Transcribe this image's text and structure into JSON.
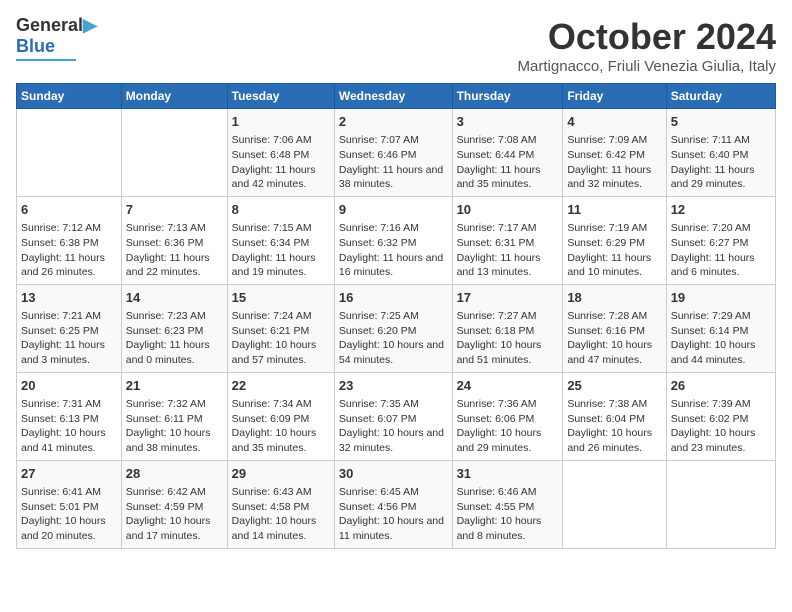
{
  "header": {
    "logo_line1": "General",
    "logo_line2": "Blue",
    "month": "October 2024",
    "location": "Martignacco, Friuli Venezia Giulia, Italy"
  },
  "days_of_week": [
    "Sunday",
    "Monday",
    "Tuesday",
    "Wednesday",
    "Thursday",
    "Friday",
    "Saturday"
  ],
  "weeks": [
    [
      {
        "day": "",
        "info": ""
      },
      {
        "day": "",
        "info": ""
      },
      {
        "day": "1",
        "info": "Sunrise: 7:06 AM\nSunset: 6:48 PM\nDaylight: 11 hours and 42 minutes."
      },
      {
        "day": "2",
        "info": "Sunrise: 7:07 AM\nSunset: 6:46 PM\nDaylight: 11 hours and 38 minutes."
      },
      {
        "day": "3",
        "info": "Sunrise: 7:08 AM\nSunset: 6:44 PM\nDaylight: 11 hours and 35 minutes."
      },
      {
        "day": "4",
        "info": "Sunrise: 7:09 AM\nSunset: 6:42 PM\nDaylight: 11 hours and 32 minutes."
      },
      {
        "day": "5",
        "info": "Sunrise: 7:11 AM\nSunset: 6:40 PM\nDaylight: 11 hours and 29 minutes."
      }
    ],
    [
      {
        "day": "6",
        "info": "Sunrise: 7:12 AM\nSunset: 6:38 PM\nDaylight: 11 hours and 26 minutes."
      },
      {
        "day": "7",
        "info": "Sunrise: 7:13 AM\nSunset: 6:36 PM\nDaylight: 11 hours and 22 minutes."
      },
      {
        "day": "8",
        "info": "Sunrise: 7:15 AM\nSunset: 6:34 PM\nDaylight: 11 hours and 19 minutes."
      },
      {
        "day": "9",
        "info": "Sunrise: 7:16 AM\nSunset: 6:32 PM\nDaylight: 11 hours and 16 minutes."
      },
      {
        "day": "10",
        "info": "Sunrise: 7:17 AM\nSunset: 6:31 PM\nDaylight: 11 hours and 13 minutes."
      },
      {
        "day": "11",
        "info": "Sunrise: 7:19 AM\nSunset: 6:29 PM\nDaylight: 11 hours and 10 minutes."
      },
      {
        "day": "12",
        "info": "Sunrise: 7:20 AM\nSunset: 6:27 PM\nDaylight: 11 hours and 6 minutes."
      }
    ],
    [
      {
        "day": "13",
        "info": "Sunrise: 7:21 AM\nSunset: 6:25 PM\nDaylight: 11 hours and 3 minutes."
      },
      {
        "day": "14",
        "info": "Sunrise: 7:23 AM\nSunset: 6:23 PM\nDaylight: 11 hours and 0 minutes."
      },
      {
        "day": "15",
        "info": "Sunrise: 7:24 AM\nSunset: 6:21 PM\nDaylight: 10 hours and 57 minutes."
      },
      {
        "day": "16",
        "info": "Sunrise: 7:25 AM\nSunset: 6:20 PM\nDaylight: 10 hours and 54 minutes."
      },
      {
        "day": "17",
        "info": "Sunrise: 7:27 AM\nSunset: 6:18 PM\nDaylight: 10 hours and 51 minutes."
      },
      {
        "day": "18",
        "info": "Sunrise: 7:28 AM\nSunset: 6:16 PM\nDaylight: 10 hours and 47 minutes."
      },
      {
        "day": "19",
        "info": "Sunrise: 7:29 AM\nSunset: 6:14 PM\nDaylight: 10 hours and 44 minutes."
      }
    ],
    [
      {
        "day": "20",
        "info": "Sunrise: 7:31 AM\nSunset: 6:13 PM\nDaylight: 10 hours and 41 minutes."
      },
      {
        "day": "21",
        "info": "Sunrise: 7:32 AM\nSunset: 6:11 PM\nDaylight: 10 hours and 38 minutes."
      },
      {
        "day": "22",
        "info": "Sunrise: 7:34 AM\nSunset: 6:09 PM\nDaylight: 10 hours and 35 minutes."
      },
      {
        "day": "23",
        "info": "Sunrise: 7:35 AM\nSunset: 6:07 PM\nDaylight: 10 hours and 32 minutes."
      },
      {
        "day": "24",
        "info": "Sunrise: 7:36 AM\nSunset: 6:06 PM\nDaylight: 10 hours and 29 minutes."
      },
      {
        "day": "25",
        "info": "Sunrise: 7:38 AM\nSunset: 6:04 PM\nDaylight: 10 hours and 26 minutes."
      },
      {
        "day": "26",
        "info": "Sunrise: 7:39 AM\nSunset: 6:02 PM\nDaylight: 10 hours and 23 minutes."
      }
    ],
    [
      {
        "day": "27",
        "info": "Sunrise: 6:41 AM\nSunset: 5:01 PM\nDaylight: 10 hours and 20 minutes."
      },
      {
        "day": "28",
        "info": "Sunrise: 6:42 AM\nSunset: 4:59 PM\nDaylight: 10 hours and 17 minutes."
      },
      {
        "day": "29",
        "info": "Sunrise: 6:43 AM\nSunset: 4:58 PM\nDaylight: 10 hours and 14 minutes."
      },
      {
        "day": "30",
        "info": "Sunrise: 6:45 AM\nSunset: 4:56 PM\nDaylight: 10 hours and 11 minutes."
      },
      {
        "day": "31",
        "info": "Sunrise: 6:46 AM\nSunset: 4:55 PM\nDaylight: 10 hours and 8 minutes."
      },
      {
        "day": "",
        "info": ""
      },
      {
        "day": "",
        "info": ""
      }
    ]
  ]
}
